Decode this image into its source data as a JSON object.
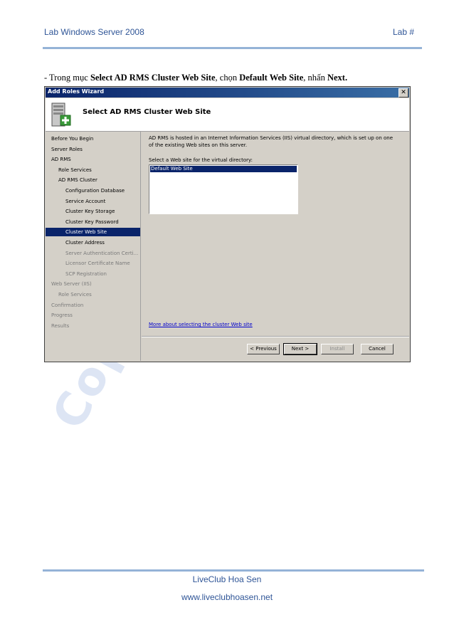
{
  "page": {
    "header_left": "Lab Windows Server 2008",
    "header_right": "Lab #",
    "instruction": {
      "prefix": "- Trong mục ",
      "bold1": "Select AD RMS Cluster Web Site",
      "mid1": ", chọn ",
      "bold2": "Default Web Site",
      "mid2": ", nhấn ",
      "bold3": "Next."
    },
    "watermark": "Copyright© 2",
    "footer_line1": "LiveClub Hoa Sen",
    "footer_line2": "www.liveclubhoasen.net"
  },
  "dialog": {
    "title": "Add Roles Wizard",
    "close_glyph": "✕",
    "banner_title": "Select AD RMS Cluster Web Site",
    "nav": [
      {
        "label": "Before You Begin",
        "indent": 0,
        "state": "normal"
      },
      {
        "label": "Server Roles",
        "indent": 0,
        "state": "normal"
      },
      {
        "label": "AD RMS",
        "indent": 0,
        "state": "normal"
      },
      {
        "label": "Role Services",
        "indent": 1,
        "state": "normal"
      },
      {
        "label": "AD RMS Cluster",
        "indent": 1,
        "state": "normal"
      },
      {
        "label": "Configuration Database",
        "indent": 2,
        "state": "normal"
      },
      {
        "label": "Service Account",
        "indent": 2,
        "state": "normal"
      },
      {
        "label": "Cluster Key Storage",
        "indent": 2,
        "state": "normal"
      },
      {
        "label": "Cluster Key Password",
        "indent": 2,
        "state": "normal"
      },
      {
        "label": "Cluster Web Site",
        "indent": 2,
        "state": "selected"
      },
      {
        "label": "Cluster Address",
        "indent": 2,
        "state": "normal"
      },
      {
        "label": "Server Authentication Certi...",
        "indent": 2,
        "state": "disabled"
      },
      {
        "label": "Licensor Certificate Name",
        "indent": 2,
        "state": "disabled"
      },
      {
        "label": "SCP Registration",
        "indent": 2,
        "state": "disabled"
      },
      {
        "label": "Web Server (IIS)",
        "indent": 0,
        "state": "disabled"
      },
      {
        "label": "Role Services",
        "indent": 1,
        "state": "disabled"
      },
      {
        "label": "Confirmation",
        "indent": 0,
        "state": "disabled"
      },
      {
        "label": "Progress",
        "indent": 0,
        "state": "disabled"
      },
      {
        "label": "Results",
        "indent": 0,
        "state": "disabled"
      }
    ],
    "description": "AD RMS is hosted in an Internet Information Services (IIS) virtual directory, which is set up on one of the existing Web sites on this server.",
    "list_label": "Select a Web site for the virtual directory:",
    "list_items": [
      "Default Web Site"
    ],
    "selected_item": "Default Web Site",
    "more_link": "More about selecting the cluster Web site",
    "buttons": {
      "previous": "< Previous",
      "next": "Next >",
      "install": "Install",
      "cancel": "Cancel"
    },
    "colors": {
      "selection": "#0a246a",
      "face": "#d4d0c8",
      "link": "#0000cc"
    }
  }
}
